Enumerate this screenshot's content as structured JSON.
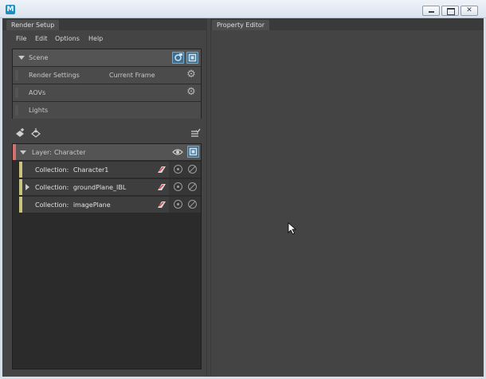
{
  "window": {
    "app_icon": "maya-icon"
  },
  "left_tab": {
    "label": "Render Setup"
  },
  "right_tab": {
    "label": "Property Editor"
  },
  "menu": {
    "items": [
      "File",
      "Edit",
      "Options",
      "Help"
    ]
  },
  "scene": {
    "label": "Scene",
    "rows": [
      {
        "label": "Render Settings",
        "value": "Current Frame",
        "icon": "gear-icon"
      },
      {
        "label": "AOVs",
        "icon": "gear-icon"
      },
      {
        "label": "Lights"
      }
    ]
  },
  "toolbar": {
    "icons": [
      "create-layer-icon",
      "import-icon",
      "checklist-icon"
    ]
  },
  "layer": {
    "prefix": "Layer:",
    "name": "Character",
    "color": "#d4716f"
  },
  "collections": [
    {
      "prefix": "Collection:",
      "name": "Character1",
      "expandable": false,
      "color": "#c9c37e"
    },
    {
      "prefix": "Collection:",
      "name": "groundPlane_IBL",
      "expandable": true,
      "color": "#c9c37e"
    },
    {
      "prefix": "Collection:",
      "name": "imagePlane",
      "expandable": false,
      "color": "#c9c37e"
    }
  ],
  "colors": {
    "accent_blue": "#3f6f90",
    "panel_bg": "#444444",
    "list_bg": "#2b2b2b"
  }
}
